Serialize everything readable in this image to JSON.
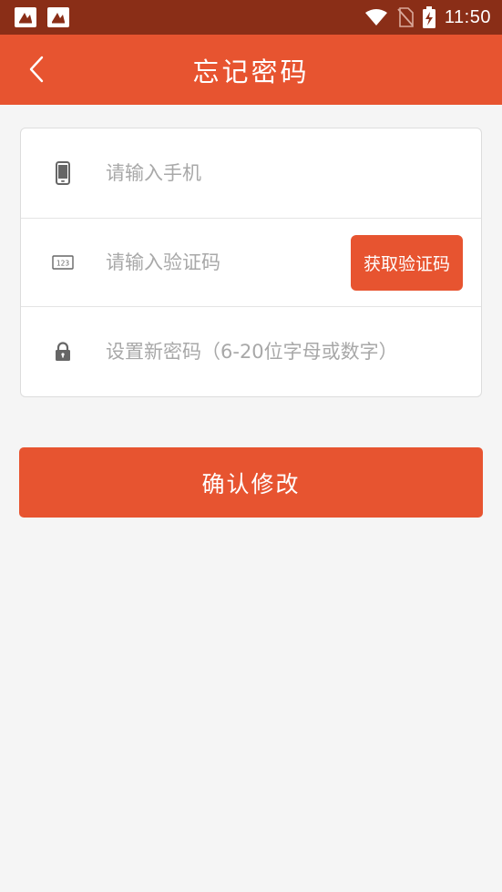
{
  "status_bar": {
    "time": "11:50",
    "icons": [
      "app-notification-icon",
      "app-notification-icon",
      "wifi-icon",
      "no-sim-icon",
      "battery-charging-icon"
    ]
  },
  "app_bar": {
    "title": "忘记密码",
    "back_icon": "chevron-left-icon"
  },
  "form": {
    "phone": {
      "icon": "phone-icon",
      "value": "",
      "placeholder": "请输入手机"
    },
    "code": {
      "icon": "code-123-icon",
      "value": "",
      "placeholder": "请输入验证码",
      "button_label": "获取验证码"
    },
    "password": {
      "icon": "lock-icon",
      "value": "",
      "placeholder": "设置新密码（6-20位字母或数字）"
    }
  },
  "confirm_label": "确认修改",
  "colors": {
    "status_bar": "#8a2e17",
    "accent": "#e75430",
    "background": "#f5f5f5",
    "placeholder": "#a8a8a8",
    "icon": "#666666"
  }
}
